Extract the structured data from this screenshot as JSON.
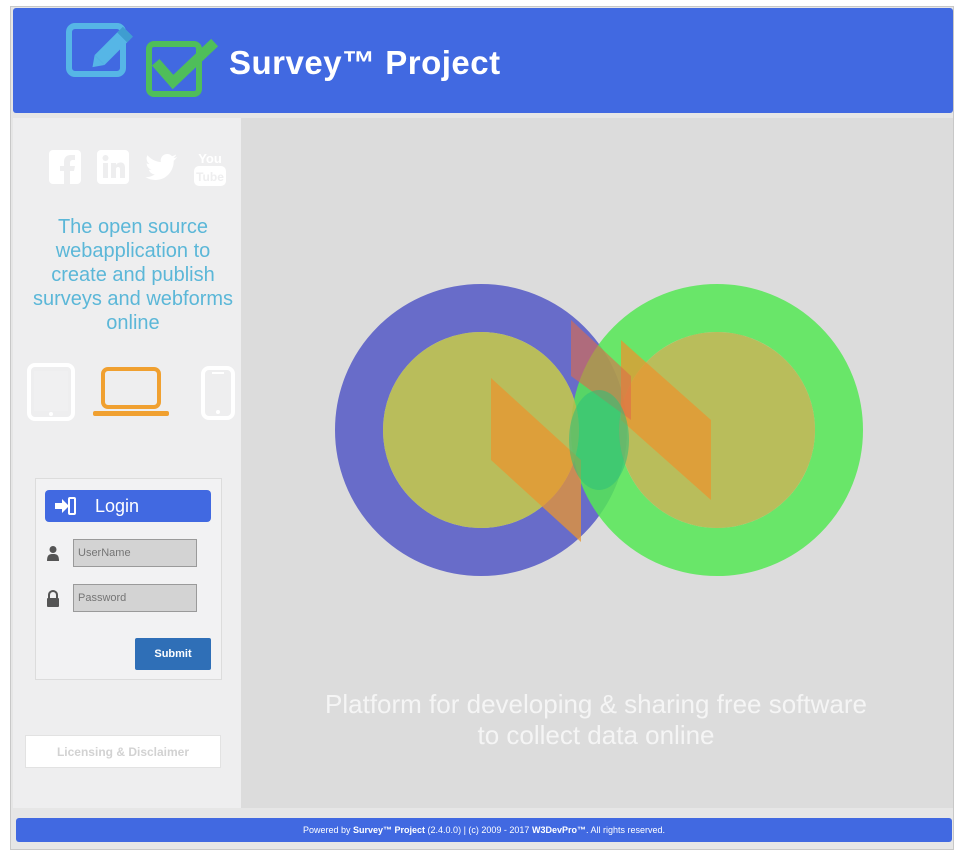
{
  "header": {
    "title": "Survey™ Project",
    "logo_icons": [
      "pencil-edit-icon",
      "checkbox-check-icon"
    ],
    "bg_color": "#4169e1"
  },
  "sidebar": {
    "social_icons": [
      "facebook-icon",
      "linkedin-icon",
      "twitter-icon",
      "youtube-icon"
    ],
    "tagline": "The open source webapplication to create and publish surveys and webforms online",
    "device_icons": [
      "tablet-icon",
      "laptop-icon",
      "phone-icon"
    ],
    "login": {
      "title": "Login",
      "username_placeholder": "UserName",
      "password_placeholder": "Password",
      "submit_label": "Submit"
    },
    "license_label": "Licensing & Disclaimer"
  },
  "main": {
    "platform_text_line1": "Platform for developing & sharing free software",
    "platform_text_line2": "to collect data online"
  },
  "footer": {
    "prefix": "Powered by ",
    "brand": "Survey™ Project",
    "middle": " (2.4.0.0) | (c) 2009 - 2017 ",
    "company": "W3DevPro™",
    "suffix": ". All rights reserved."
  },
  "colors": {
    "accent": "#4169e1",
    "tagline": "#5bb7d8",
    "submit": "#2f6fb7",
    "laptop": "#f0a030"
  }
}
